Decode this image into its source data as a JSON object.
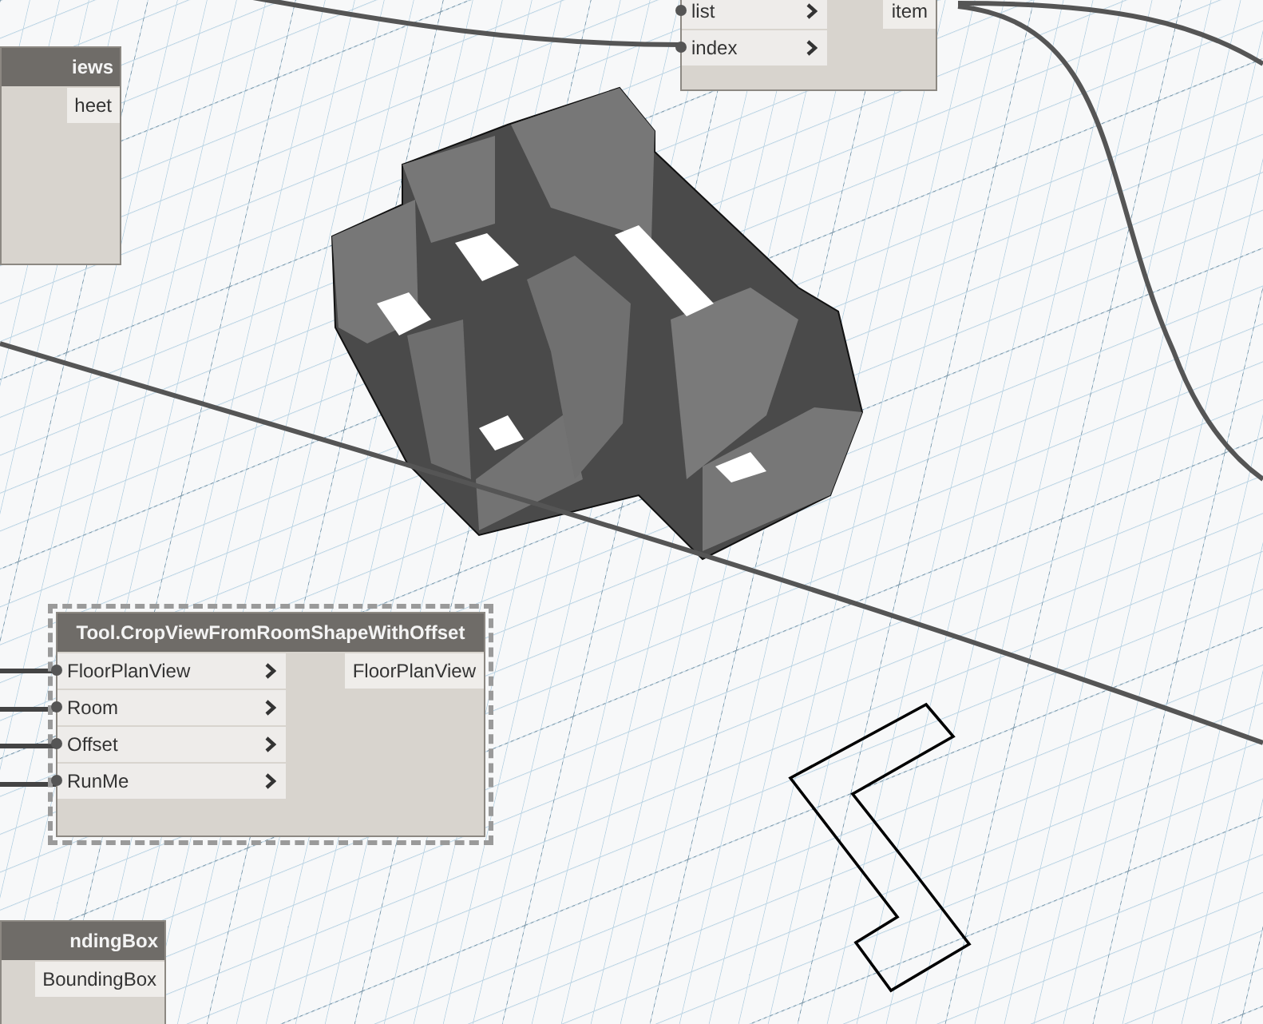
{
  "nodes": [
    {
      "title": "iews",
      "selected": false,
      "outputs": [
        "heet"
      ]
    },
    {
      "selected": false,
      "inputs": [
        "list",
        "index"
      ],
      "outputs": [
        "item"
      ]
    },
    {
      "title": "Tool.CropViewFromRoomShapeWithOffset",
      "selected": true,
      "inputs": [
        "FloorPlanView",
        "Room",
        "Offset",
        "RunMe"
      ],
      "outputs": [
        "FloorPlanView"
      ]
    },
    {
      "title": "ndingBox",
      "selected": false,
      "outputs": [
        "BoundingBox"
      ]
    }
  ]
}
